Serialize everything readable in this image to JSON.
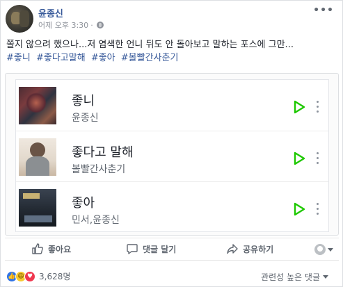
{
  "post": {
    "author": "윤종신",
    "time": "어제 오후 3:30",
    "separator": "·",
    "text": "쫄지 않으려 했으나...저 염색한 언니 뒤도 안 돌아보고 말하는 포스에 그만...",
    "hashtags": [
      "#좋니",
      "#좋다고말해",
      "#좋아",
      "#볼빨간사춘기"
    ]
  },
  "music": {
    "tracks": [
      {
        "title": "좋니",
        "artist": "윤종신"
      },
      {
        "title": "좋다고 말해",
        "artist": "볼빨간사춘기"
      },
      {
        "title": "좋아",
        "artist": "민서,윤종신"
      }
    ]
  },
  "actions": {
    "like": "좋아요",
    "comment": "댓글 달기",
    "share": "공유하기"
  },
  "reactions": {
    "count": "3,628명",
    "sort_label": "관련성 높은 댓글"
  },
  "icons": {
    "like": "thumbs-up-icon",
    "comment": "comment-icon",
    "share": "share-icon",
    "play": "play-icon",
    "more": "more-horizontal-icon",
    "privacy": "globe-icon"
  },
  "colors": {
    "link": "#365899",
    "play_green": "#1ec800",
    "like_blue": "#2f73e6",
    "love_red": "#f0384f",
    "haha_yellow": "#f7c92f"
  }
}
